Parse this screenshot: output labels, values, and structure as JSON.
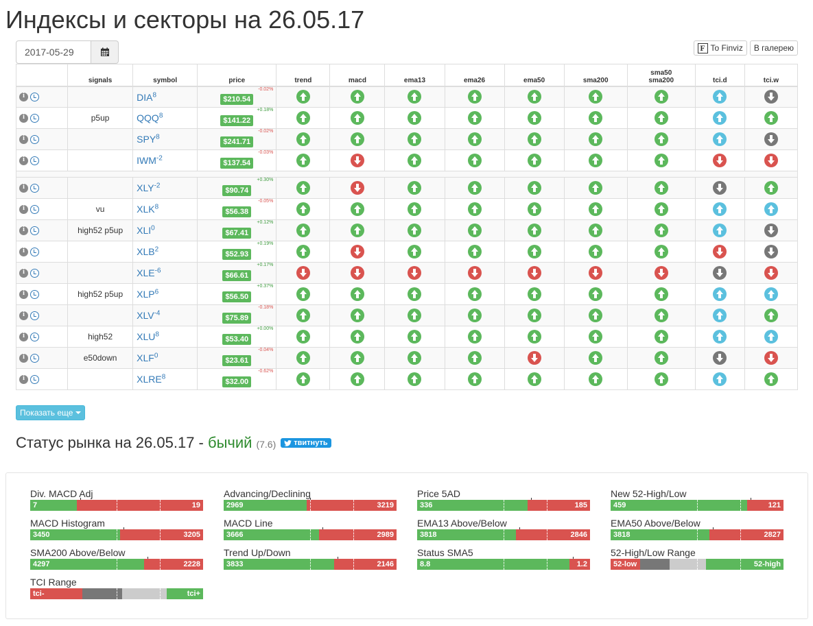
{
  "page": {
    "title": "Индексы и секторы на 26.05.17"
  },
  "date_picker": {
    "value": "2017-05-29",
    "icon": "calendar-icon"
  },
  "toolbar": {
    "finviz_label": "To Finviz",
    "gallery_label": "В галерею"
  },
  "table": {
    "headers": [
      "signals",
      "symbol",
      "price",
      "trend",
      "macd",
      "ema13",
      "ema26",
      "ema50",
      "sma200",
      "sma50\nsma200",
      "tci.d",
      "tci.w"
    ],
    "groups": [
      [
        {
          "signal": "",
          "symbol": "DIA",
          "sup": "8",
          "change": "-0.02%",
          "price": "$210.54",
          "arrows": [
            "up",
            "up",
            "up",
            "up",
            "up",
            "up",
            "up",
            "up-blue",
            "down-gray"
          ]
        },
        {
          "signal": "p5up",
          "symbol": "QQQ",
          "sup": "8",
          "change": "+0.18%",
          "price": "$141.22",
          "arrows": [
            "up",
            "up",
            "up",
            "up",
            "up",
            "up",
            "up",
            "up-blue",
            "up"
          ]
        },
        {
          "signal": "",
          "symbol": "SPY",
          "sup": "8",
          "change": "-0.02%",
          "price": "$241.71",
          "arrows": [
            "up",
            "up",
            "up",
            "up",
            "up",
            "up",
            "up",
            "up-blue",
            "down-gray"
          ]
        },
        {
          "signal": "",
          "symbol": "IWM",
          "sup": "-2",
          "change": "-0.03%",
          "price": "$137.54",
          "arrows": [
            "up",
            "down",
            "up",
            "up",
            "up",
            "up",
            "up",
            "down",
            "down"
          ]
        }
      ],
      [
        {
          "signal": "",
          "symbol": "XLY",
          "sup": "-2",
          "change": "+0.30%",
          "price": "$90.74",
          "arrows": [
            "up",
            "down",
            "up",
            "up",
            "up",
            "up",
            "up",
            "down-gray",
            "up"
          ]
        },
        {
          "signal": "vu",
          "symbol": "XLK",
          "sup": "8",
          "change": "-0.05%",
          "price": "$56.38",
          "arrows": [
            "up",
            "up",
            "up",
            "up",
            "up",
            "up",
            "up",
            "up-blue",
            "up-blue"
          ]
        },
        {
          "signal": "high52 p5up",
          "symbol": "XLI",
          "sup": "0",
          "change": "+0.12%",
          "price": "$67.41",
          "arrows": [
            "up",
            "up",
            "up",
            "up",
            "up",
            "up",
            "up",
            "up-blue",
            "down-gray"
          ]
        },
        {
          "signal": "",
          "symbol": "XLB",
          "sup": "2",
          "change": "+0.19%",
          "price": "$52.93",
          "arrows": [
            "up",
            "down",
            "up",
            "up",
            "up",
            "up",
            "up",
            "down",
            "down-gray"
          ]
        },
        {
          "signal": "",
          "symbol": "XLE",
          "sup": "-6",
          "change": "+0.17%",
          "price": "$66.61",
          "arrows": [
            "down",
            "down",
            "down",
            "down",
            "down",
            "down",
            "down",
            "down-gray",
            "down"
          ]
        },
        {
          "signal": "high52 p5up",
          "symbol": "XLP",
          "sup": "6",
          "change": "+0.37%",
          "price": "$56.50",
          "arrows": [
            "up",
            "up",
            "up",
            "up",
            "up",
            "up",
            "up",
            "up-blue",
            "up-blue"
          ]
        },
        {
          "signal": "",
          "symbol": "XLV",
          "sup": "-4",
          "change": "-0.18%",
          "price": "$75.89",
          "arrows": [
            "up",
            "up",
            "up",
            "up",
            "up",
            "up",
            "up",
            "up-blue",
            "up"
          ]
        },
        {
          "signal": "high52",
          "symbol": "XLU",
          "sup": "8",
          "change": "+0.00%",
          "price": "$53.40",
          "arrows": [
            "up",
            "up",
            "up",
            "up",
            "up",
            "up",
            "up",
            "up-blue",
            "up-blue"
          ]
        },
        {
          "signal": "e50down",
          "symbol": "XLF",
          "sup": "0",
          "change": "-0.04%",
          "price": "$23.61",
          "arrows": [
            "up",
            "up",
            "up",
            "up",
            "down",
            "up",
            "up",
            "down-gray",
            "down"
          ]
        },
        {
          "signal": "",
          "symbol": "XLRE",
          "sup": "8",
          "change": "-0.62%",
          "price": "$32.00",
          "arrows": [
            "up",
            "up",
            "up",
            "up",
            "up",
            "up",
            "up",
            "up-blue",
            "up"
          ]
        }
      ]
    ]
  },
  "show_more": {
    "label": "Показать еще"
  },
  "status": {
    "prefix": "Статус рынка на 26.05.17 - ",
    "verdict": "бычий",
    "score": "(7.6)",
    "tweet_label": "твитнуть"
  },
  "bars": [
    {
      "label": "Div. MACD Adj",
      "left": "7",
      "right": "19",
      "green_fraction": 0.27
    },
    {
      "label": "Advancing/Declining",
      "left": "2969",
      "right": "3219",
      "green_fraction": 0.48
    },
    {
      "label": "Price 5AD",
      "left": "336",
      "right": "185",
      "green_fraction": 0.64
    },
    {
      "label": "New 52-High/Low",
      "left": "459",
      "right": "121",
      "green_fraction": 0.79
    },
    {
      "label": "MACD Histogram",
      "left": "3450",
      "right": "3205",
      "green_fraction": 0.52
    },
    {
      "label": "MACD Line",
      "left": "3666",
      "right": "2989",
      "green_fraction": 0.55
    },
    {
      "label": "EMA13 Above/Below",
      "left": "3818",
      "right": "2846",
      "green_fraction": 0.57
    },
    {
      "label": "EMA50 Above/Below",
      "left": "3818",
      "right": "2827",
      "green_fraction": 0.57
    },
    {
      "label": "SMA200 Above/Below",
      "left": "4297",
      "right": "2228",
      "green_fraction": 0.66
    },
    {
      "label": "Trend Up/Down",
      "left": "3833",
      "right": "2146",
      "green_fraction": 0.64
    },
    {
      "label": "Status SMA5",
      "left": "8.8",
      "right": "1.2",
      "green_fraction": 0.88
    },
    {
      "label": "52-High/Low Range",
      "left": "52-low",
      "right": "52-high",
      "range": true,
      "reverse": true
    },
    {
      "label": "TCI Range",
      "left": "tci-",
      "right": "tci+",
      "range": true,
      "reverse": false
    }
  ],
  "colors": {
    "green": "#5cb85c",
    "red": "#d9534f",
    "blue": "#5bc0de",
    "gray": "#777777",
    "link": "#337ab7",
    "bullish": "#2e8b2e"
  }
}
